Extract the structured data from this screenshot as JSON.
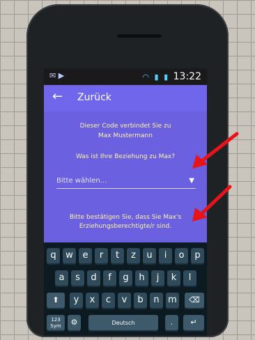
{
  "status": {
    "time": "13:22"
  },
  "appbar": {
    "back_label": "Zurück"
  },
  "content": {
    "code_line": "Dieser Code verbindet Sie zu",
    "name_line": "Max Mustermann",
    "question": "Was ist Ihre Beziehung zu Max?",
    "dropdown_placeholder": "Bitte wählen...",
    "confirm_line1": "Bitte bestätigen Sie, dass Sie Max's",
    "confirm_line2": "Erziehungsberechtigte/r sind."
  },
  "keyboard": {
    "row1": [
      "q",
      "w",
      "e",
      "r",
      "t",
      "z",
      "u",
      "i",
      "o",
      "p"
    ],
    "row2": [
      "a",
      "s",
      "d",
      "f",
      "g",
      "h",
      "j",
      "k",
      "l"
    ],
    "row3": [
      "y",
      "x",
      "c",
      "v",
      "b",
      "n",
      "m"
    ],
    "sym_label": "123 Sym",
    "space_label": "Deutsch",
    "shift_icon": "shift-icon",
    "backspace_icon": "backspace-icon",
    "enter_icon": "enter-icon",
    "settings_icon": "gear-icon"
  },
  "colors": {
    "screen_bg": "#6a60e0",
    "accent_text": "#fff3b0",
    "arrow_red": "#e8141a"
  }
}
